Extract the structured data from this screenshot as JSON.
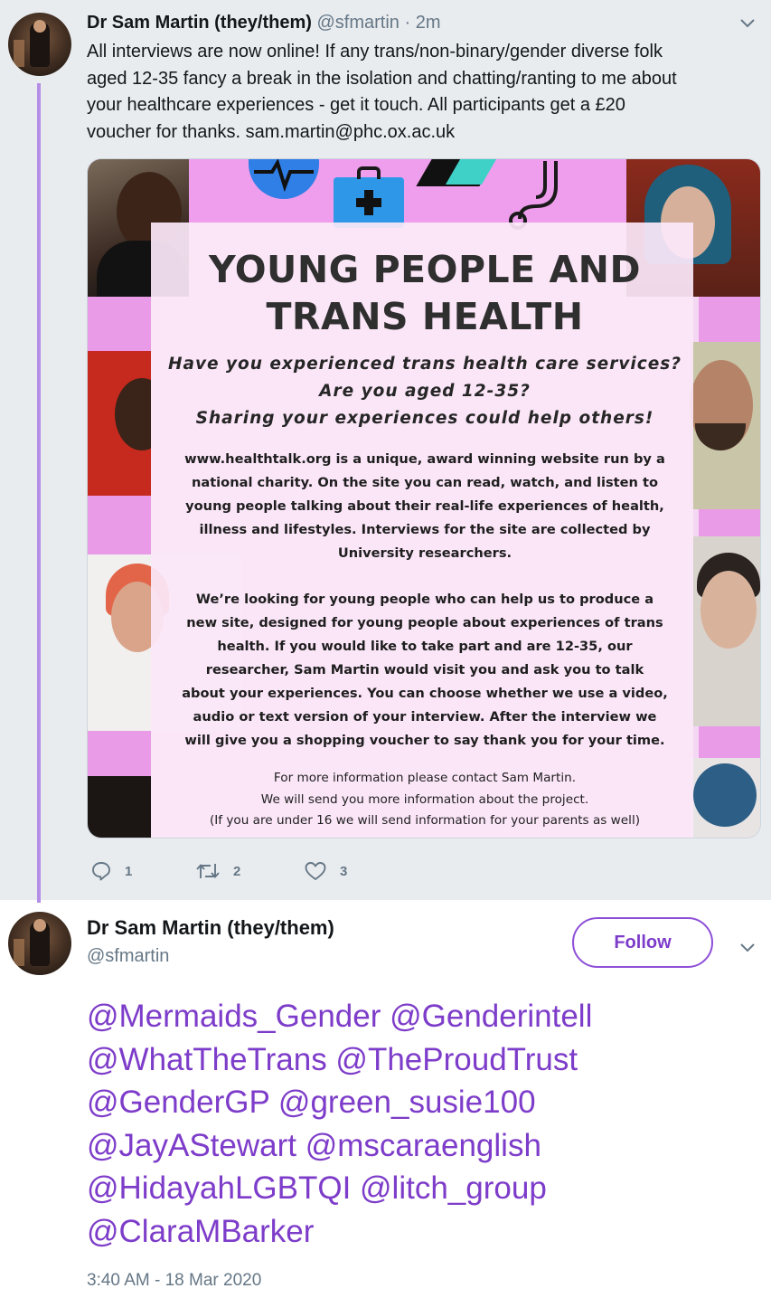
{
  "reply_tweet": {
    "author_name": "Dr Sam Martin (they/them)",
    "handle": "@sfmartin",
    "separator": "·",
    "time_ago": "2m",
    "text_lines": [
      "All interviews are now online! If any trans/non-binary/gender diverse folk",
      "aged 12-35 fancy a break in the isolation and chatting/ranting to me about",
      "your healthcare experiences - get it touch.  All participants get a £20",
      "voucher for thanks. sam.martin@phc.ox.ac.uk"
    ],
    "poster": {
      "title_lines": [
        "YOUNG PEOPLE AND",
        "TRANS HEALTH"
      ],
      "question_lines": [
        "Have you experienced trans health care services?",
        "Are you aged 12-35?",
        "Sharing your experiences could help others!"
      ],
      "para1_lines": [
        "www.healthtalk.org is a unique, award winning website run by a",
        "national charity.  On the site you can read, watch, and listen to",
        "young people talking about their real-life experiences of health,",
        "illness and lifestyles. Interviews for the site are collected by",
        "University researchers."
      ],
      "para2_lines": [
        "We’re looking for young people who can help us to produce a",
        "new site, designed for young people about experiences of trans",
        "health. If you would like to take part and are 12-35, our",
        "researcher, Sam Martin  would visit you and ask you to talk",
        "about your experiences. You can choose whether we use a video,",
        "audio or text version of your interview. After the interview we",
        "will give you a shopping voucher to say thank you for your time."
      ],
      "para3_lines": [
        "For more information please contact Sam Martin.",
        "We will send you more information about the project.",
        "(If you are under 16 we will send information for your parents as well)"
      ],
      "colors": {
        "band": "#ea9be8",
        "panel": "#fbe7f9",
        "accent_blue": "#2f8fe3",
        "accent_teal": "#3fd0c8"
      }
    },
    "actions": {
      "reply_count": "1",
      "retweet_count": "2",
      "like_count": "3"
    },
    "icons": {
      "reply": "reply-icon",
      "retweet": "retweet-icon",
      "like": "heart-icon",
      "menu": "chevron-down-icon"
    }
  },
  "main_tweet": {
    "author_name": "Dr Sam Martin (they/them)",
    "handle": "@sfmartin",
    "follow_label": "Follow",
    "mention_lines": [
      "@Mermaids_Gender @Genderintell",
      "@WhatTheTrans @TheProudTrust",
      "@GenderGP @green_susie100",
      "@JayAStewart @mscaraenglish",
      "@HidayahLGBTQI @litch_group",
      "@ClaraMBarker"
    ],
    "timestamp": "3:40 AM - 18 Mar 2020"
  },
  "colors": {
    "thread_line": "#b58ee6",
    "accent": "#7d3cc9",
    "secondary_text": "#657786",
    "reply_bg": "#e9ecef"
  }
}
